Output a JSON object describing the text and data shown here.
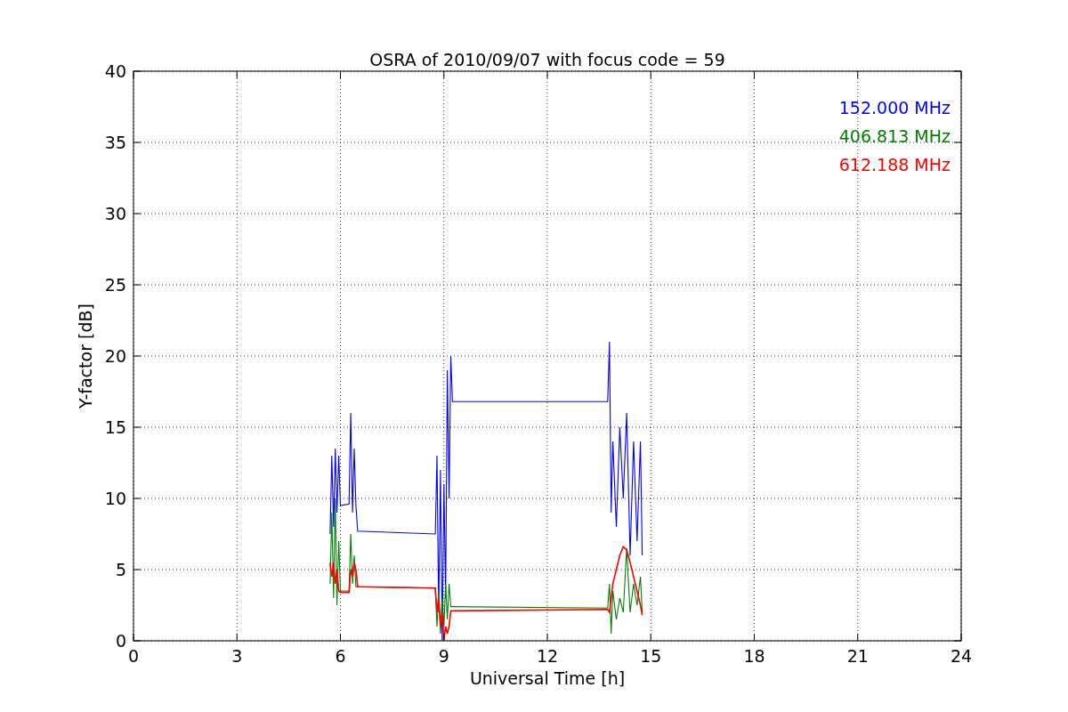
{
  "chart_data": {
    "type": "line",
    "title": "OSRA of 2010/09/07 with focus code = 59",
    "xlabel": "Universal Time [h]",
    "ylabel": "Y-factor [dB]",
    "x": [
      5.7,
      5.75,
      5.8,
      5.85,
      5.9,
      5.95,
      6.0,
      6.25,
      6.3,
      6.35,
      6.4,
      6.45,
      6.5,
      8.75,
      8.8,
      8.85,
      8.9,
      8.95,
      9.0,
      9.05,
      9.1,
      9.15,
      9.2,
      9.25,
      13.75,
      13.8,
      13.85,
      13.9,
      14.0,
      14.1,
      14.2,
      14.3,
      14.4,
      14.5,
      14.6,
      14.7,
      14.75
    ],
    "series": [
      {
        "name": "152.000 MHz",
        "color": "#0000ff",
        "values": [
          7.5,
          13,
          8,
          13.5,
          9,
          13,
          9.5,
          9.6,
          16,
          9,
          13.5,
          9.5,
          7.7,
          7.5,
          13,
          2,
          12,
          0,
          11,
          3,
          19,
          10,
          20,
          16.8,
          16.8,
          21,
          9,
          14,
          8,
          15,
          10,
          16,
          6,
          14,
          7,
          14,
          6
        ]
      },
      {
        "name": "406.813 MHz",
        "color": "#008000",
        "values": [
          4,
          9,
          3,
          10,
          2.5,
          7,
          3.5,
          3.5,
          7.5,
          4,
          6,
          3.8,
          3.8,
          3.7,
          1,
          3.5,
          0.5,
          3,
          1,
          4,
          1.5,
          4,
          2.4,
          2.4,
          2.3,
          4,
          0.5,
          3.5,
          1.5,
          3,
          2,
          6.5,
          2,
          4,
          2.5,
          4.5,
          2
        ]
      },
      {
        "name": "612.188 MHz",
        "color": "#ff0000",
        "values": [
          5.5,
          4.5,
          5.5,
          4,
          5,
          3.5,
          3.4,
          3.4,
          5,
          4.5,
          5.5,
          5,
          3.8,
          3.7,
          2,
          3,
          1,
          2,
          0,
          1,
          0.5,
          1,
          2.1,
          2.1,
          2.2,
          2,
          3,
          4,
          5,
          6,
          6.6,
          6.4,
          5.5,
          4.5,
          3.5,
          2.5,
          1.8
        ]
      }
    ],
    "xlim": [
      0,
      24
    ],
    "ylim": [
      0,
      40
    ],
    "xticks": [
      0,
      3,
      6,
      9,
      12,
      15,
      18,
      21,
      24
    ],
    "yticks": [
      0,
      5,
      10,
      15,
      20,
      25,
      30,
      35,
      40
    ],
    "grid": true
  }
}
